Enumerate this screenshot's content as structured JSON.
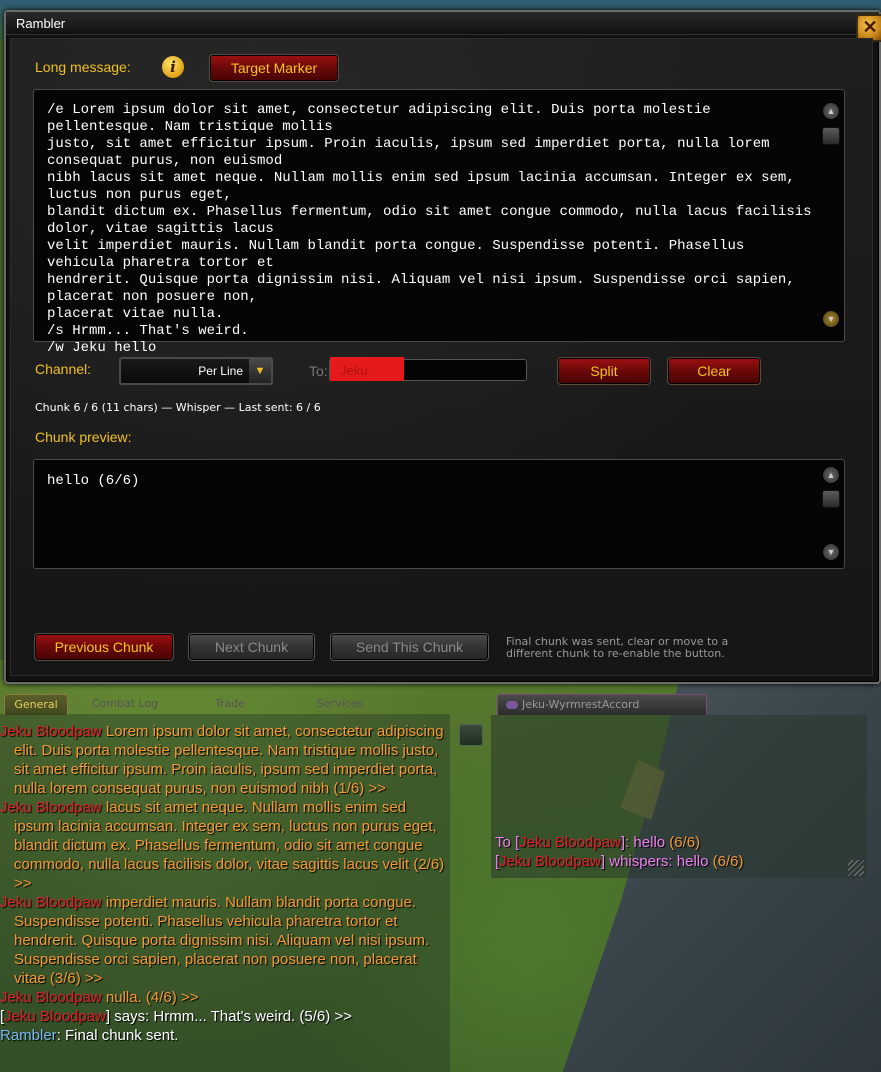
{
  "window": {
    "title": "Rambler",
    "close_glyph": "✕"
  },
  "form": {
    "long_message_label": "Long message:",
    "target_marker_label": "Target Marker",
    "message_text": "/e Lorem ipsum dolor sit amet, consectetur adipiscing elit. Duis porta molestie pellentesque. Nam tristique mollis\njusto, sit amet efficitur ipsum. Proin iaculis, ipsum sed imperdiet porta, nulla lorem consequat purus, non euismod\nnibh lacus sit amet neque. Nullam mollis enim sed ipsum lacinia accumsan. Integer ex sem, luctus non purus eget,\nblandit dictum ex. Phasellus fermentum, odio sit amet congue commodo, nulla lacus facilisis dolor, vitae sagittis lacus\nvelit imperdiet mauris. Nullam blandit porta congue. Suspendisse potenti. Phasellus vehicula pharetra tortor et\nhendrerit. Quisque porta dignissim nisi. Aliquam vel nisi ipsum. Suspendisse orci sapien, placerat non posuere non,\nplacerat vitae nulla.\n/s Hrmm... That's weird.\n/w Jeku hello",
    "channel_label": "Channel:",
    "channel_value": "Per Line",
    "to_label": "To:",
    "to_value": "Jeku",
    "split_label": "Split",
    "clear_label": "Clear",
    "status": "Chunk 6 / 6 (11 chars) — Whisper — Last sent: 6 / 6",
    "preview_label": "Chunk preview:",
    "preview_text": "hello (6/6)",
    "prev_label": "Previous Chunk",
    "next_label": "Next Chunk",
    "send_label": "Send This Chunk",
    "hint": "Final chunk was sent, clear or move to a different chunk to re-enable the button.",
    "info_glyph": "i"
  },
  "chat": {
    "tabs": [
      "General",
      "Combat Log",
      "Trade",
      "Services"
    ],
    "whisper_tab": "Jeku-WyrmrestAccord",
    "general_lines": [
      {
        "name": "Jeku Bloodpaw",
        "text": " Lorem ipsum dolor sit amet, consectetur adipiscing elit. Duis porta molestie pellentesque. Nam tristique mollis justo, sit amet efficitur ipsum. Proin iaculis, ipsum sed imperdiet porta, nulla lorem consequat purus, non euismod nibh (1/6) >>"
      },
      {
        "name": "Jeku Bloodpaw",
        "text": " lacus sit amet neque. Nullam mollis enim sed ipsum lacinia accumsan. Integer ex sem, luctus non purus eget, blandit dictum ex. Phasellus fermentum, odio sit amet congue commodo, nulla lacus facilisis dolor, vitae sagittis lacus velit (2/6) >>"
      },
      {
        "name": "Jeku Bloodpaw",
        "text": " imperdiet mauris. Nullam blandit porta congue. Suspendisse potenti. Phasellus vehicula pharetra tortor et hendrerit. Quisque porta dignissim nisi. Aliquam vel nisi ipsum. Suspendisse orci sapien, placerat non posuere non, placerat vitae (3/6) >>"
      },
      {
        "name": "Jeku Bloodpaw",
        "text": " nulla. (4/6) >>"
      }
    ],
    "say_line": {
      "open": "[",
      "name": "Jeku Bloodpaw",
      "close": "]",
      "text": " says: Hrmm... That's weird. (5/6) >>"
    },
    "system_line": {
      "name": "Rambler",
      "text": ": Final chunk sent."
    },
    "whisper_lines": [
      {
        "prefix": "To [",
        "name": "Jeku Bloodpaw",
        "suffix": "]: hello",
        "count": " (6/6)"
      },
      {
        "prefix": "[",
        "name": "Jeku Bloodpaw",
        "suffix": "] whispers: hello",
        "count": " (6/6)"
      }
    ]
  },
  "colors": {
    "gold": "#f0c020",
    "chat_name": "#e0202a",
    "emote": "#f39a3a",
    "whisper": "#f080f0",
    "addon": "#7ab8f0"
  }
}
